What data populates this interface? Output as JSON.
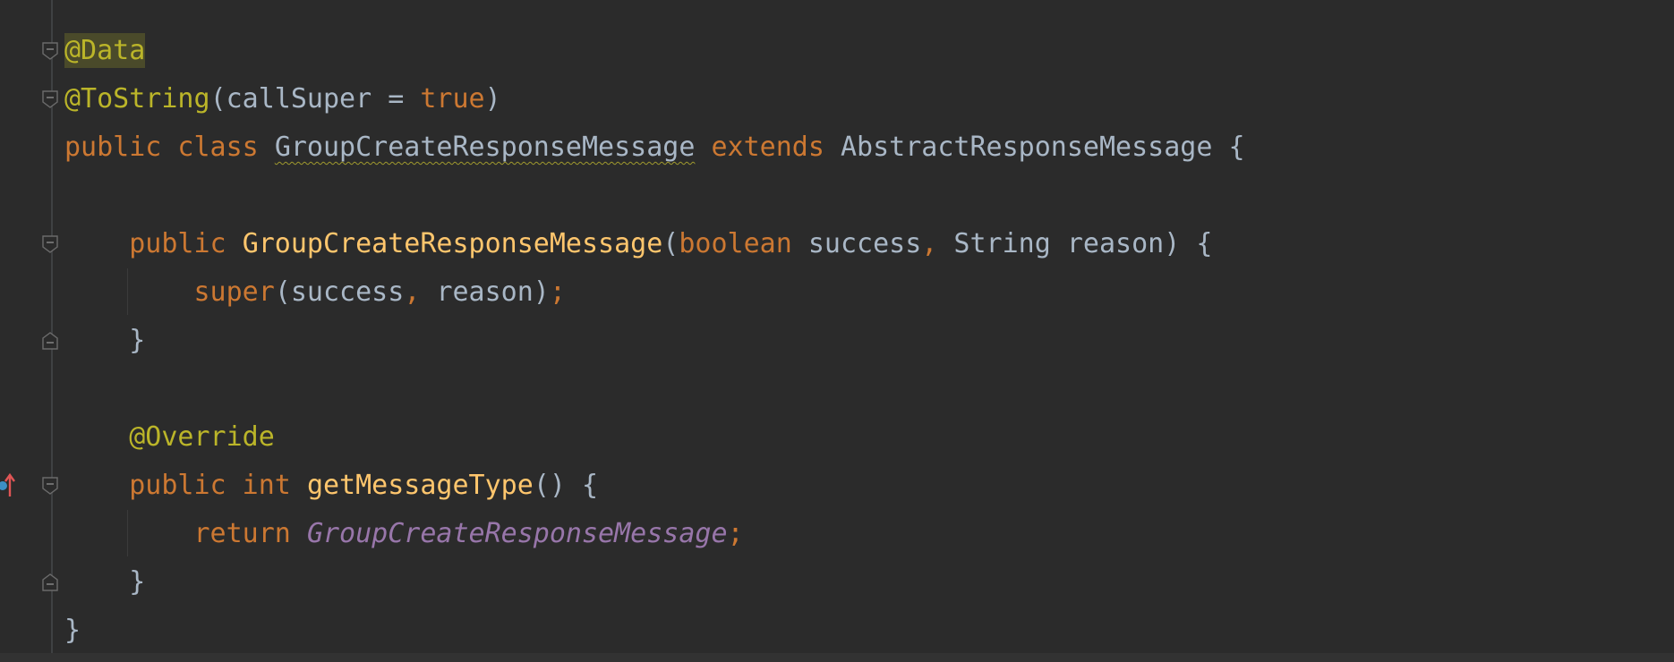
{
  "editor": {
    "lines": [
      {
        "tokens": [
          {
            "text": "@Data",
            "cls": "ann hl"
          }
        ]
      },
      {
        "tokens": [
          {
            "text": "@ToString",
            "cls": "ann"
          },
          {
            "text": "(callSuper = ",
            "cls": "plain"
          },
          {
            "text": "true",
            "cls": "kw"
          },
          {
            "text": ")",
            "cls": "plain"
          }
        ]
      },
      {
        "tokens": [
          {
            "text": "public class ",
            "cls": "kw"
          },
          {
            "text": "GroupCreateResponseMessage",
            "cls": "cls warn"
          },
          {
            "text": " extends ",
            "cls": "kw"
          },
          {
            "text": "AbstractResponseMessage {",
            "cls": "plain"
          }
        ]
      },
      {
        "tokens": []
      },
      {
        "tokens": [
          {
            "text": "    public ",
            "cls": "kw"
          },
          {
            "text": "GroupCreateResponseMessage",
            "cls": "fn"
          },
          {
            "text": "(",
            "cls": "plain"
          },
          {
            "text": "boolean ",
            "cls": "kw"
          },
          {
            "text": "success",
            "cls": "plain"
          },
          {
            "text": ", ",
            "cls": "kw"
          },
          {
            "text": "String reason) {",
            "cls": "plain"
          }
        ]
      },
      {
        "tokens": [
          {
            "text": "        super",
            "cls": "kw"
          },
          {
            "text": "(success",
            "cls": "plain"
          },
          {
            "text": ", ",
            "cls": "kw"
          },
          {
            "text": "reason)",
            "cls": "plain"
          },
          {
            "text": ";",
            "cls": "kw"
          }
        ]
      },
      {
        "tokens": [
          {
            "text": "    }",
            "cls": "plain"
          }
        ]
      },
      {
        "tokens": []
      },
      {
        "tokens": [
          {
            "text": "    @Override",
            "cls": "ann"
          }
        ]
      },
      {
        "tokens": [
          {
            "text": "    public int ",
            "cls": "kw"
          },
          {
            "text": "getMessageType",
            "cls": "fn"
          },
          {
            "text": "() {",
            "cls": "plain"
          }
        ]
      },
      {
        "tokens": [
          {
            "text": "        return ",
            "cls": "kw"
          },
          {
            "text": "GroupCreateResponseMessage",
            "cls": "const"
          },
          {
            "text": ";",
            "cls": "kw"
          }
        ]
      },
      {
        "tokens": [
          {
            "text": "    }",
            "cls": "plain"
          }
        ]
      },
      {
        "tokens": [
          {
            "text": "}",
            "cls": "plain"
          }
        ]
      }
    ]
  },
  "gutter": {
    "fold_rows": [
      0,
      1,
      4,
      6,
      9,
      11
    ],
    "fold_close_rows": [
      6,
      11
    ],
    "guide_rows": [
      5,
      10
    ],
    "override_marker_row": 9
  },
  "colors": {
    "background": "#2b2b2b",
    "keyword": "#cc7832",
    "annotation": "#bbb529",
    "method": "#ffc66d",
    "text": "#a9b7c6",
    "constant": "#9876aa"
  }
}
